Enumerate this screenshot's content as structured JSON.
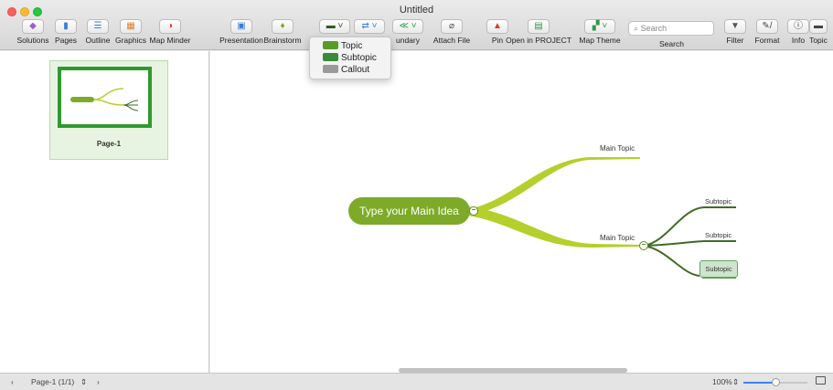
{
  "window": {
    "title": "Untitled"
  },
  "toolbar_left": [
    {
      "label": "Solutions",
      "icon": "solutions-icon",
      "glyph": "◆",
      "color": "#a05cc8"
    },
    {
      "label": "Pages",
      "icon": "pages-icon",
      "glyph": "▮",
      "color": "#3d7bd8"
    },
    {
      "label": "Outline",
      "icon": "outline-icon",
      "glyph": "☰",
      "color": "#3d7bd8"
    },
    {
      "label": "Graphics",
      "icon": "graphics-icon",
      "glyph": "▦",
      "color": "#e07f2d"
    },
    {
      "label": "Map Minder",
      "icon": "map-minder-icon",
      "glyph": "◑",
      "color": "#d93b34"
    }
  ],
  "toolbar_main": [
    {
      "label": "Presentation",
      "icon": "presentation-icon",
      "glyph": "▣",
      "color": "#3d7bd8"
    },
    {
      "label": "Brainstorm",
      "icon": "brainstorm-icon",
      "glyph": "♦",
      "color": "#7aa82d"
    },
    {
      "label": "",
      "icon": "insert-topic-icon",
      "glyph": "▬ ˅",
      "color": "#2f5a1c"
    },
    {
      "label": "",
      "icon": "relationship-icon",
      "glyph": "⇄ ˅",
      "color": "#3d7bd8"
    },
    {
      "label": "undary",
      "icon": "boundary-icon",
      "glyph": "≪ ˅",
      "color": "#2e9a4a"
    },
    {
      "label": "Attach File",
      "icon": "attach-file-icon",
      "glyph": "⌀",
      "color": "#555"
    },
    {
      "label": "Pin",
      "icon": "pin-icon",
      "glyph": "▲",
      "color": "#d93b34"
    },
    {
      "label": "Open in PROJECT",
      "icon": "open-project-icon",
      "glyph": "▤",
      "color": "#2e9a4a"
    },
    {
      "label": "Map Theme",
      "icon": "map-theme-icon",
      "glyph": "▞ ˅",
      "color": "#2e9a4a"
    }
  ],
  "search": {
    "placeholder": "Search",
    "label": "Search"
  },
  "toolbar_right": [
    {
      "label": "Filter",
      "icon": "filter-icon",
      "glyph": "▼",
      "color": "#555"
    },
    {
      "label": "Format",
      "icon": "format-icon",
      "glyph": "✎/",
      "color": "#444"
    },
    {
      "label": "Info",
      "icon": "info-icon",
      "glyph": "ⓘ",
      "color": "#333"
    },
    {
      "label": "Topic",
      "icon": "topic-icon",
      "glyph": "▬",
      "color": "#444"
    }
  ],
  "dropdown": {
    "items": [
      {
        "label": "Topic",
        "color": "#5a9a2a"
      },
      {
        "label": "Subtopic",
        "color": "#3a8a3a"
      },
      {
        "label": "Callout",
        "color": "#8a8a8a"
      }
    ]
  },
  "sidebar": {
    "page_label": "Page-1"
  },
  "mindmap": {
    "main_idea": "Type your Main Idea",
    "main_topics": [
      "Main Topic",
      "Main Topic"
    ],
    "subtopics": [
      "Subtopic",
      "Subtopic",
      "Subtopic"
    ],
    "branch_color": "#b5cf2c",
    "sub_color": "#3f6b26",
    "collapse_glyph": "−"
  },
  "statusbar": {
    "page": "Page-1 (1/1)",
    "zoom": "100%",
    "zoom_level": 0.5
  }
}
